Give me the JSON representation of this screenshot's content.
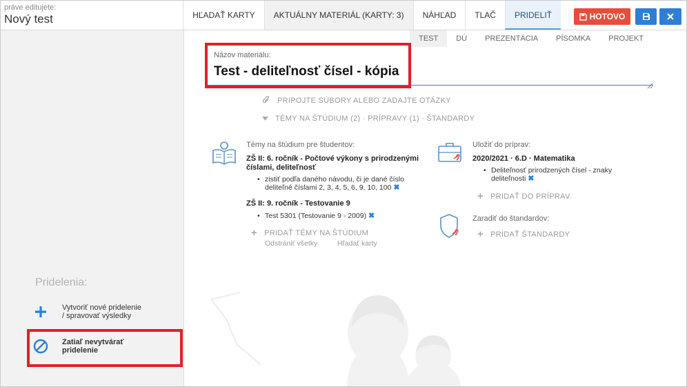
{
  "header": {
    "editing_caption": "práve editujete:",
    "doc_title": "Nový test",
    "tabs": [
      {
        "label": "HĽADAŤ KARTY"
      },
      {
        "label": "AKTUÁLNY MATERIÁL (KARTY: 3)"
      },
      {
        "label": "NÁHĽAD"
      },
      {
        "label": "TLAČ"
      },
      {
        "label": "PRIDELIŤ"
      }
    ],
    "done_label": "HOTOVO",
    "save_icon": "floppy-icon",
    "close_icon": "x-icon",
    "done_color": "#e74c3c",
    "primary_color": "#2d7fd6"
  },
  "sidebar": {
    "heading": "Pridelenia:",
    "create_line1": "Vytvoriť nové pridelenie",
    "create_line2": "/ spravovať výsledky",
    "none_line1": "Zatiaľ nevytvárať",
    "none_line2": "pridelenie"
  },
  "main": {
    "type_tabs": [
      "TEST",
      "DÚ",
      "PREZENTÁCIA",
      "PÍSOMKA",
      "PROJEKT"
    ],
    "name_label": "Názov materiálu:",
    "name_value": "Test - deliteľnosť čísel - kópia",
    "attach_label": "PRIPOJTE SÚBORY ALEBO ZADAJTE OTÁZKY",
    "toggle_label": "TÉMY NA ŠTÚDIUM (2) · PRÍPRAVY (1) · ŠTANDARDY",
    "topics": {
      "title": "Témy na štúdium pre študentov:",
      "subject1_line1": "ZŠ II: 6. ročník - Počtové výkony s prirodzenými",
      "subject1_line2": "číslami, deliteľnosť",
      "item1_line1": "zistiť podľa daného návodu, či je dané číslo",
      "item1_line2": "deliteľné číslami 2, 3, 4, 5, 6, 9, 10, 100",
      "subject2": "ZŠ II: 9. ročník - Testovanie 9",
      "item2": "Test 5301 (Testovanie 9 - 2009)",
      "add_label": "PRIDAŤ TÉMY NA ŠTÚDIUM",
      "remove_all": "Odstrániť všetky",
      "search_cards": "Hľadať karty"
    },
    "prep": {
      "title": "Uložiť do príprav:",
      "subject": "2020/2021 · 6.D · Matematika",
      "item_line1": "Deliteľnosť prirodzených čísel - znaky",
      "item_line2": "deliteľnosti",
      "add_label": "PRIDAŤ DO PRÍPRAV"
    },
    "standards": {
      "title": "Zaradiť do štandardov:",
      "add_label": "PRIDAŤ ŠTANDARDY"
    }
  }
}
